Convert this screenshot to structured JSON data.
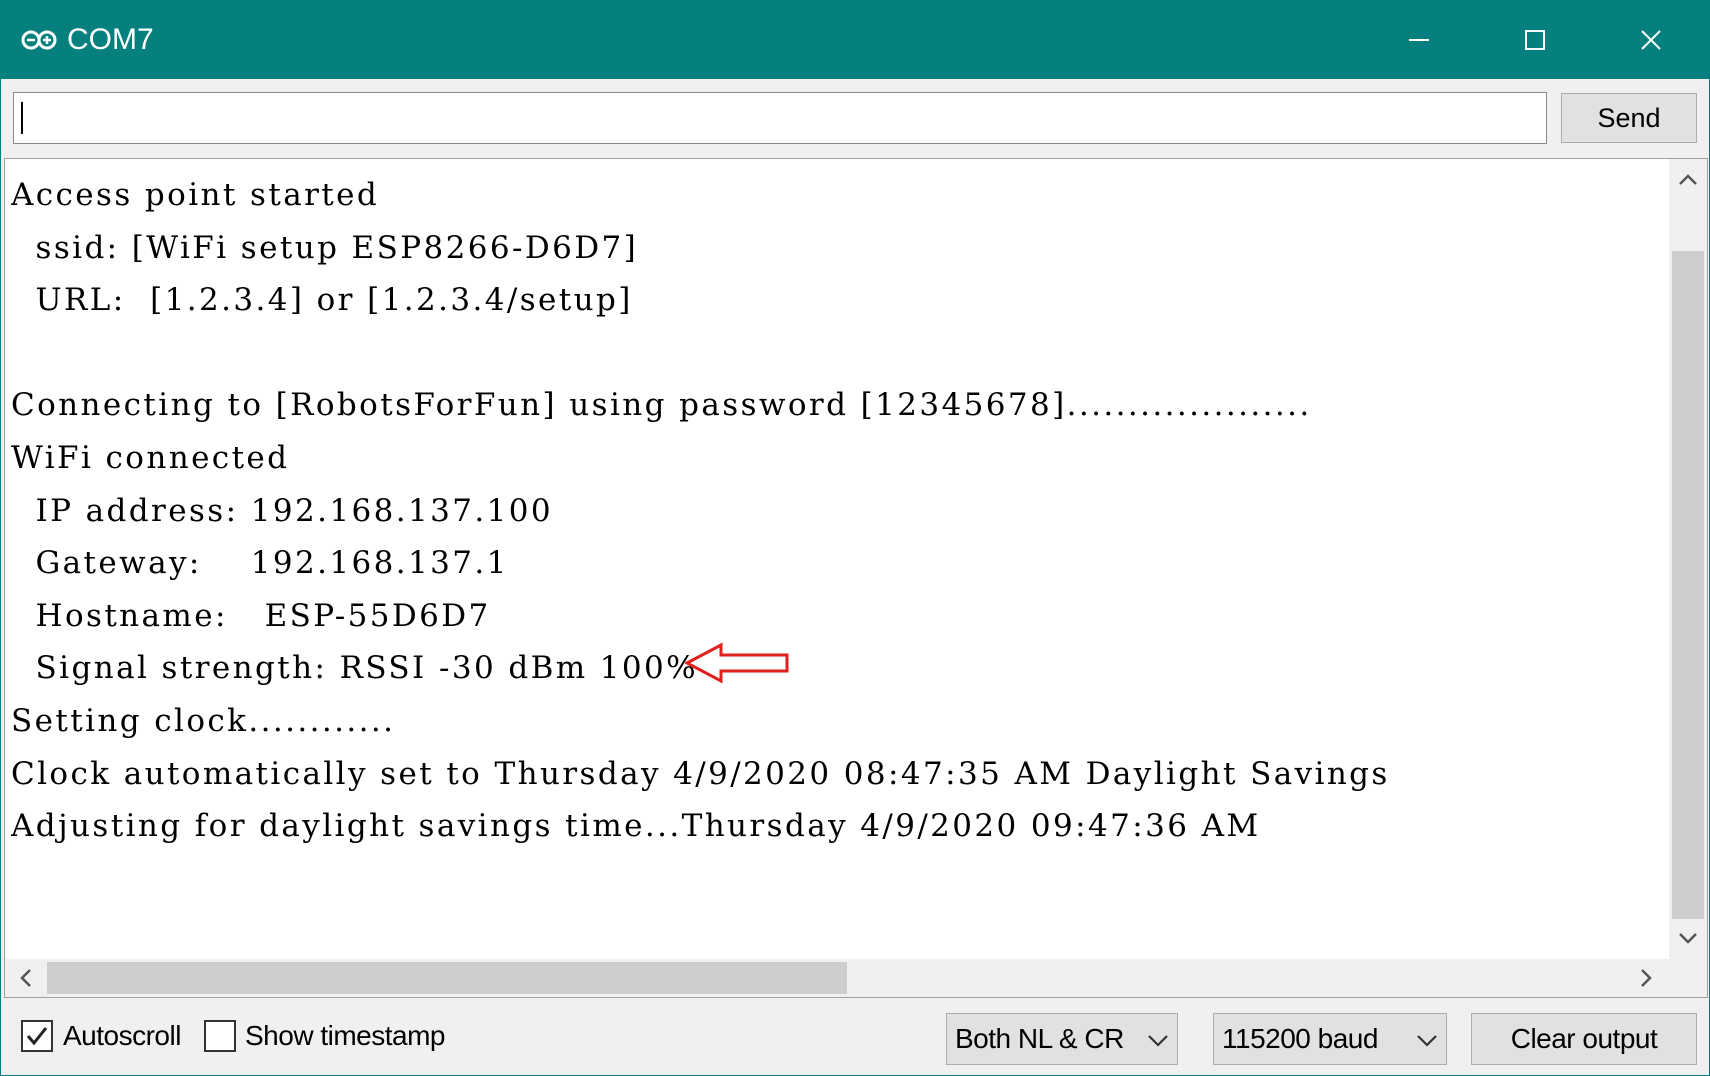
{
  "window": {
    "title": "COM7",
    "accent_color": "#06807f",
    "icons": [
      "arduino-logo-icon",
      "minimize-icon",
      "maximize-icon",
      "close-icon"
    ]
  },
  "send_bar": {
    "input_value": "",
    "send_label": "Send"
  },
  "output": {
    "lines": [
      "Access point started",
      "  ssid: [WiFi setup ESP8266-D6D7]",
      "  URL:  [1.2.3.4] or [1.2.3.4/setup]",
      "",
      "Connecting to [RobotsForFun] using password [12345678]....................",
      "WiFi connected",
      "  IP address: 192.168.137.100",
      "  Gateway:    192.168.137.1",
      "  Hostname:   ESP-55D6D7",
      "  Signal strength: RSSI -30 dBm 100%",
      "Setting clock............",
      "Clock automatically set to Thursday 4/9/2020 08:47:35 AM Daylight Savings",
      "Adjusting for daylight savings time...Thursday 4/9/2020 09:47:36 AM"
    ],
    "annotation_arrow_color": "#e0201c"
  },
  "statusbar": {
    "autoscroll_label": "Autoscroll",
    "autoscroll_checked": true,
    "timestamp_label": "Show timestamp",
    "timestamp_checked": false,
    "line_ending_value": "Both NL & CR",
    "baud_value": "115200 baud",
    "clear_label": "Clear output"
  }
}
